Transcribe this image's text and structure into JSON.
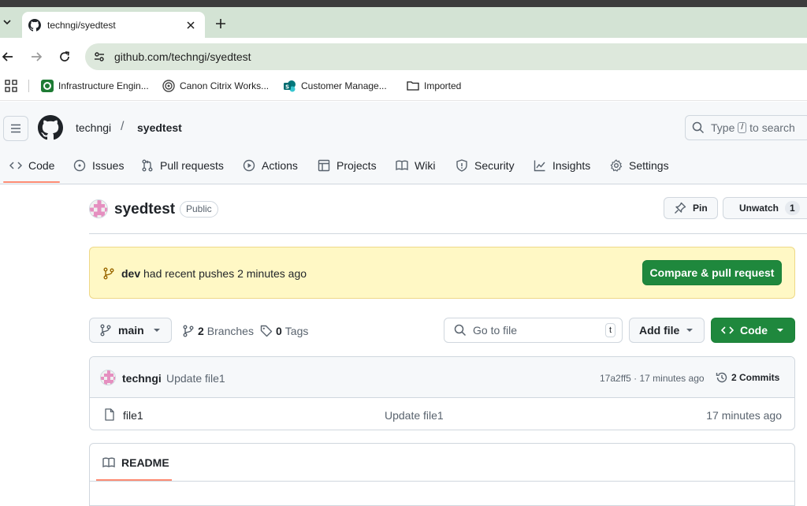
{
  "browser": {
    "tab": {
      "title": "techngi/syedtest"
    },
    "url": "github.com/techngi/syedtest",
    "bookmarks": [
      {
        "label": "Infrastructure Engin..."
      },
      {
        "label": "Canon Citrix Works..."
      },
      {
        "label": "Customer Manage..."
      },
      {
        "label": "Imported"
      }
    ]
  },
  "header": {
    "owner": "techngi",
    "separator": "/",
    "repo": "syedtest",
    "search": {
      "prefix": "Type",
      "key": "/",
      "suffix": "to search"
    }
  },
  "repo_nav": {
    "items": [
      {
        "label": "Code"
      },
      {
        "label": "Issues"
      },
      {
        "label": "Pull requests"
      },
      {
        "label": "Actions"
      },
      {
        "label": "Projects"
      },
      {
        "label": "Wiki"
      },
      {
        "label": "Security"
      },
      {
        "label": "Insights"
      },
      {
        "label": "Settings"
      }
    ]
  },
  "repo_title": {
    "name": "syedtest",
    "visibility": "Public",
    "pin_label": "Pin",
    "unwatch_label": "Unwatch",
    "watch_count": "1"
  },
  "flash": {
    "branch": "dev",
    "message": "had recent pushes 2 minutes ago",
    "button": "Compare & pull request"
  },
  "file_nav": {
    "branch": "main",
    "branches_count": "2",
    "branches_label": "Branches",
    "tags_count": "0",
    "tags_label": "Tags",
    "goto_placeholder": "Go to file",
    "goto_key": "t",
    "add_file": "Add file",
    "code_button": "Code"
  },
  "latest_commit": {
    "author": "techngi",
    "message": "Update file1",
    "meta": "17a2ff5 · 17 minutes ago",
    "commits_label": "2 Commits"
  },
  "files": [
    {
      "name": "file1",
      "message": "Update file1",
      "time": "17 minutes ago"
    }
  ],
  "readme": {
    "tab_label": "README"
  },
  "colors": {
    "primary_green": "#1f883d",
    "flash_yellow": "#fff8c5",
    "nav_underline": "#fd8c73",
    "browser_accent": "#d3e3d4"
  }
}
